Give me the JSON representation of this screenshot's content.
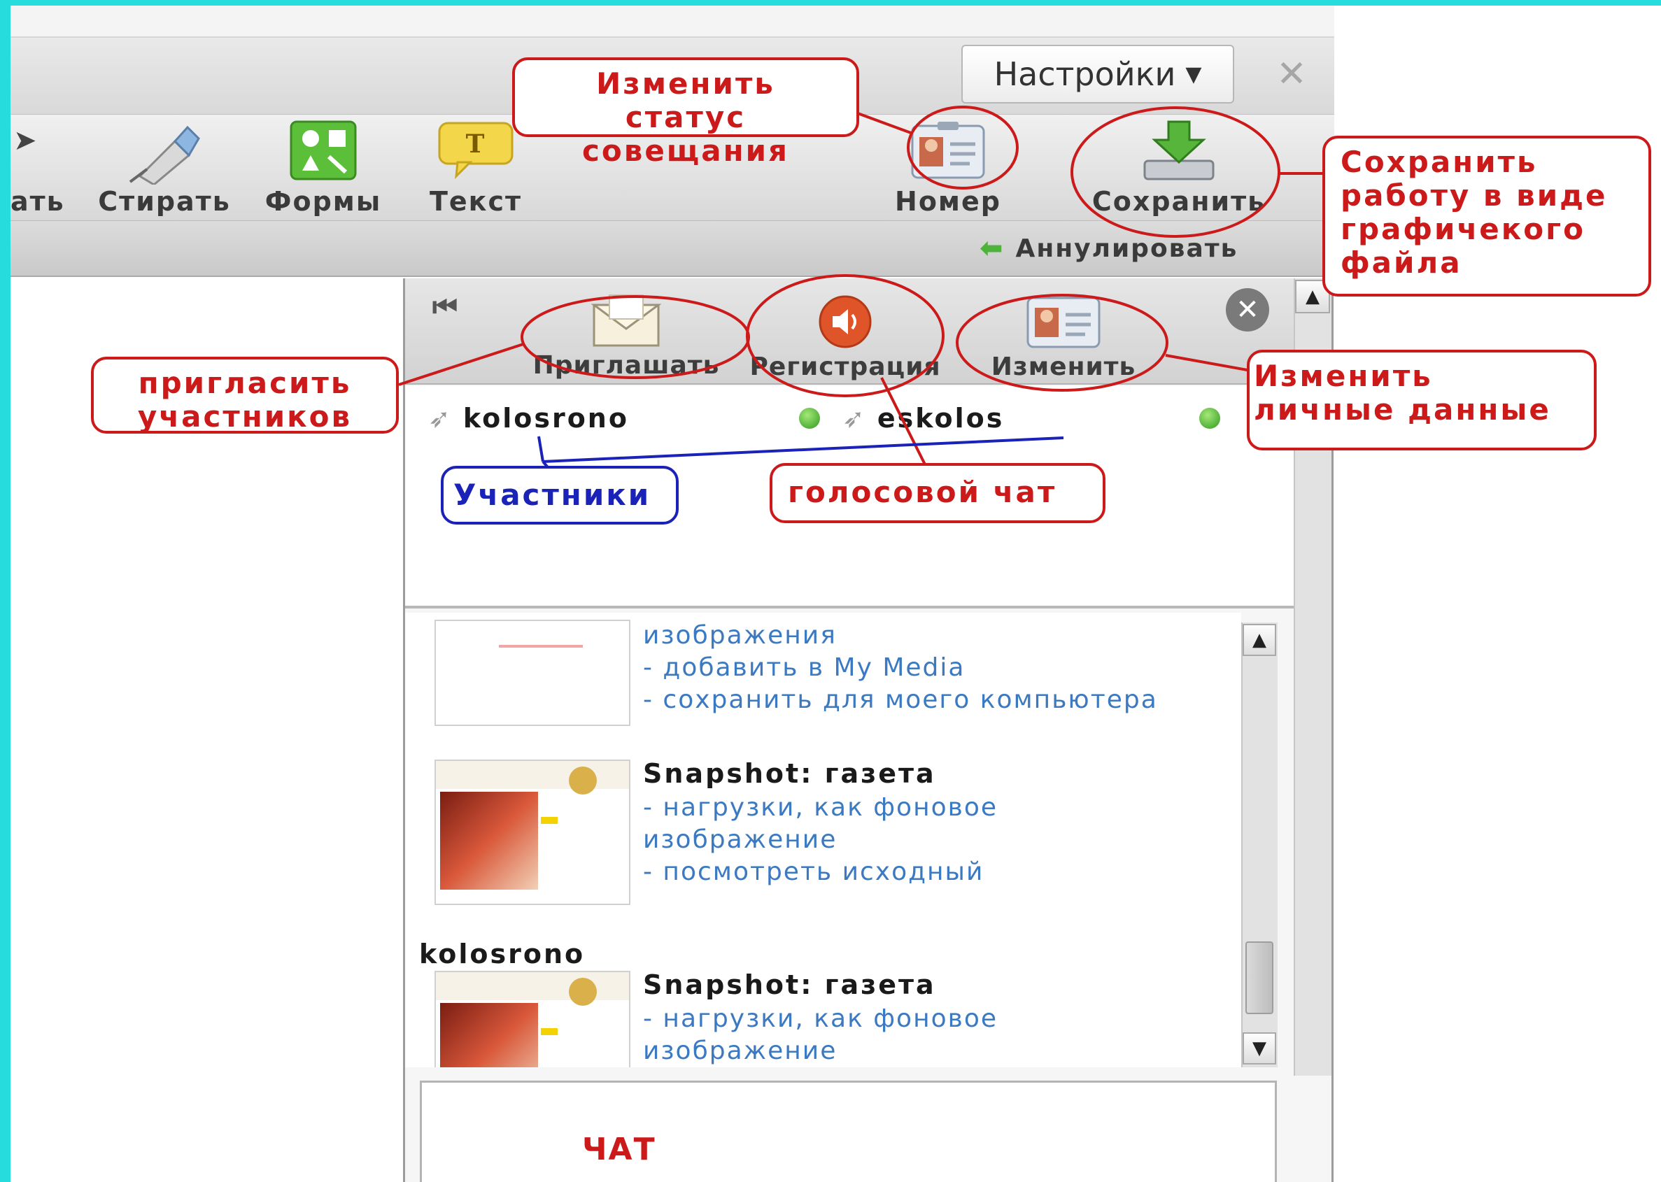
{
  "toolbar": {
    "settings_label": "Настройки",
    "partial_tool_label": "ать",
    "tools": [
      {
        "label": "Стирать",
        "icon": "eraser-icon"
      },
      {
        "label": "Формы",
        "icon": "shapes-icon"
      },
      {
        "label": "Текст",
        "icon": "text-icon"
      },
      {
        "label": "Номер ...",
        "icon": "badge-card-icon"
      },
      {
        "label": "Сохранить ...",
        "icon": "download-save-icon"
      }
    ],
    "undo_label": "Аннулировать"
  },
  "panel": {
    "buttons": [
      {
        "label": "Приглашать",
        "icon": "envelope-icon"
      },
      {
        "label": "Регистрация",
        "icon": "speaker-icon"
      },
      {
        "label": "Изменить",
        "icon": "id-card-icon"
      }
    ],
    "participants": [
      {
        "name": "kolosrono",
        "status": "online"
      },
      {
        "name": "eskolos",
        "status": "online"
      }
    ],
    "feed": {
      "top_partial": [
        "изображения",
        "- добавить в My Media",
        "- сохранить для моего компьютера"
      ],
      "items": [
        {
          "author": "",
          "title": "Snapshot: газета",
          "links": [
            "- нагрузки, как фоновое",
            "изображение",
            "- посмотреть исходный"
          ]
        },
        {
          "author": "kolosrono",
          "title": "Snapshot: газета",
          "links": [
            "- нагрузки, как фоновое",
            "изображение"
          ]
        }
      ]
    },
    "chat_label": "ЧАТ"
  },
  "annotations": {
    "change_status": "Изменить статус совещания",
    "save_graphic": "Сохранить работу в виде графичекого файла",
    "invite": "пригласить участников",
    "change_personal": "Изменить личные данные",
    "participants": "Участники",
    "voice_chat": "голосовой чат"
  },
  "colors": {
    "frame": "#27dcdc",
    "annotation_red": "#cc1a1a",
    "annotation_blue": "#1a22b8",
    "link_blue": "#3b7ac2"
  }
}
